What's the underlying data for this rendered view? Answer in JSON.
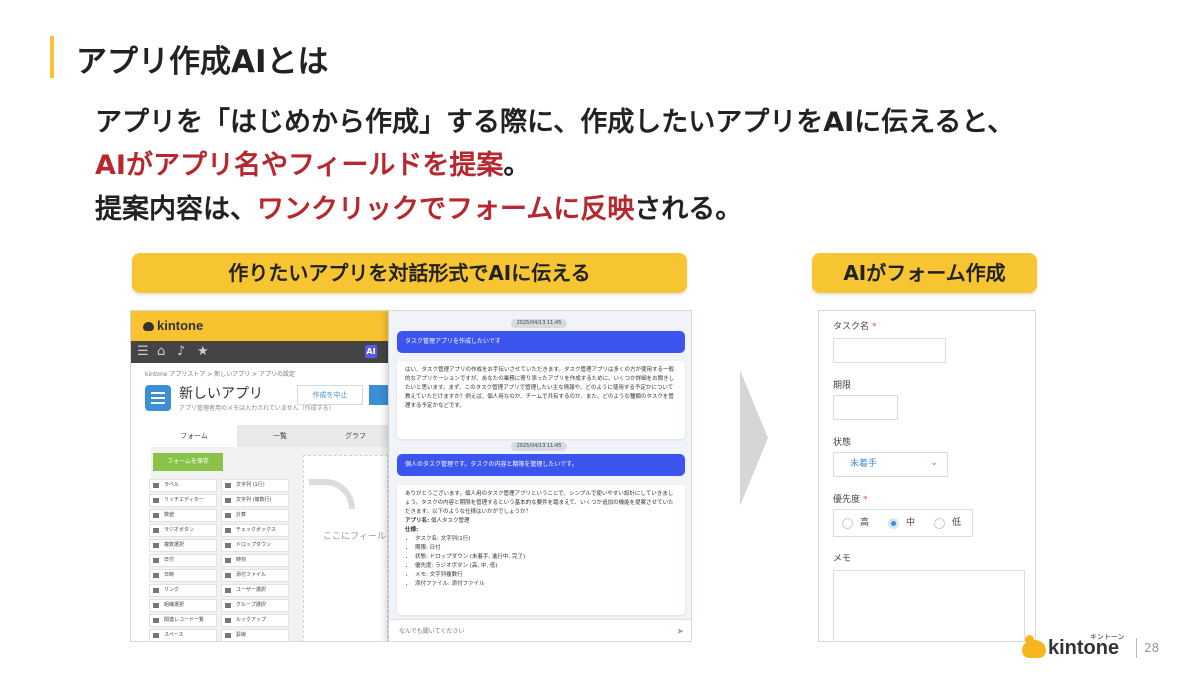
{
  "title": "アプリ作成AIとは",
  "lead": {
    "line1": "アプリを「はじめから作成」する際に、作成したいアプリをAIに伝えると、",
    "line2_red": "AIがアプリ名やフィールドを提案",
    "line2_tail": "。",
    "line3_head": "提案内容は、",
    "line3_red": "ワンクリックでフォームに反映",
    "line3_tail": "される。"
  },
  "labels": {
    "left": "作りたいアプリを対話形式でAIに伝える",
    "right": "AIがフォーム作成"
  },
  "kintone_screen": {
    "logo": "kintone",
    "ai_badge": "AI",
    "breadcrumb": "kintone アプリストア  >  新しいアプリ  >  アプリの設定",
    "app_name": "新しいアプリ",
    "app_desc": "アプリ管理者用のメモは入力されていません（作成する）",
    "cancel_button": "作成を中止",
    "tabs": [
      "フォーム",
      "一覧",
      "グラフ"
    ],
    "save_button": "フォームを保存",
    "palette": [
      "ラベル",
      "文字列 (1行)",
      "リッチエディター",
      "文字列 (複数行)",
      "数値",
      "計算",
      "ラジオボタン",
      "チェックボックス",
      "複数選択",
      "ドロップダウン",
      "日付",
      "時刻",
      "日時",
      "添付ファイル",
      "リンク",
      "ユーザー選択",
      "組織選択",
      "グループ選択",
      "関連レコード一覧",
      "ルックアップ",
      "スペース",
      "罫線"
    ],
    "drop_hint": "ここにフィールド"
  },
  "chat": {
    "timestamp1": "2025/04/13 11:45",
    "user_msg1": "タスク管理アプリを作成したいです",
    "ai_msg1": "はい、タスク管理アプリの作成をお手伝いさせていただきます。タスク管理アプリは多くの方が使用する一般的なアプリケーションですが、あなたの業務に寄り添ったアプリを作成するために、いくつか詳細をお聞きしたいと思います。まず、このタスク管理アプリで管理したい主な情報や、どのように使用する予定かについて教えていただけますか？例えば、個人用なのか、チームで共有するのか、また、どのような種類のタスクを管理する予定かなどです。",
    "timestamp2": "2025/04/13 11:45",
    "user_msg2": "個人のタスク管理です。タスクの内容と期限を管理したいです。",
    "ai_msg2_intro": "ありがとうございます。個人用のタスク管理アプリということで、シンプルで使いやすい設計にしていきましょう。タスクの内容と期限を管理するという基本的な要件を踏まえて、いくつか追加の機能を提案させていただきます。以下のような仕様はいかがでしょうか？",
    "ai_msg2_appname_label": "アプリ名:",
    "ai_msg2_appname": "個人タスク管理",
    "ai_msg2_spec_label": "仕様:",
    "ai_msg2_specs": [
      "タスク名: 文字列(1行)",
      "期限: 日付",
      "状態: ドロップダウン (未着手, 進行中, 完了)",
      "優先度: ラジオボタン (高, 中, 低)",
      "メモ: 文字列複数行",
      "添付ファイル: 添付ファイル"
    ],
    "input_placeholder": "なんでも聞いてください"
  },
  "form_preview": {
    "task_label": "タスク名",
    "required_mark": "*",
    "deadline_label": "期限",
    "status_label": "状態",
    "status_value": "未着手",
    "priority_label": "優先度",
    "priority_options": [
      "高",
      "中",
      "低"
    ],
    "priority_selected": "中",
    "memo_label": "メモ"
  },
  "footer": {
    "brand": "kintone",
    "brand_kana": "キントーン",
    "page_number": "28"
  },
  "colors": {
    "accent_yellow": "#f6c531",
    "highlight_red": "#b7282e",
    "chat_blue": "#3c55ee",
    "kintone_blue": "#3b8fd6"
  }
}
